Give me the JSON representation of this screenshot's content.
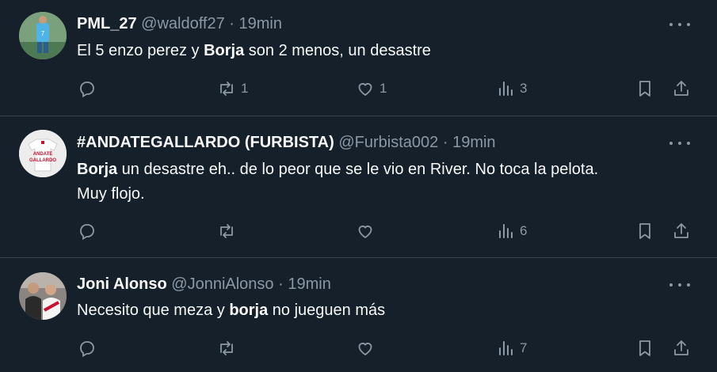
{
  "tweets": [
    {
      "name": "PML_27",
      "handle": "@waldoff27",
      "sep": "·",
      "time": "19min",
      "text_parts": [
        "El 5 enzo perez y ",
        "Borja",
        " son 2 menos, un desastre"
      ],
      "text_parts_2": [],
      "counts": {
        "reply": "",
        "retweet": "1",
        "like": "1",
        "views": "3"
      }
    },
    {
      "name": "#ANDATEGALLARDO (FURBISTA)",
      "handle": "@Furbista002",
      "sep": "·",
      "time": "19min",
      "text_parts": [
        "Borja",
        " un desastre eh.. de lo peor que se le vio en River. No toca la pelota."
      ],
      "text_parts_2": [
        "Muy flojo."
      ],
      "avatar_text": "ANDATE GALLARDO",
      "counts": {
        "reply": "",
        "retweet": "",
        "like": "",
        "views": "6"
      }
    },
    {
      "name": "Joni Alonso",
      "handle": "@JonniAlonso",
      "sep": "·",
      "time": "19min",
      "text_parts": [
        "Necesito que meza y ",
        "borja",
        " no jueguen más"
      ],
      "text_parts_2": [],
      "counts": {
        "reply": "",
        "retweet": "",
        "like": "",
        "views": "7"
      }
    }
  ],
  "icons": [
    "reply-icon",
    "retweet-icon",
    "like-icon",
    "views-icon",
    "bookmark-icon",
    "share-icon",
    "more-icon"
  ],
  "colors": {
    "background": "#15202b",
    "text": "#f7f9f9",
    "muted": "#8b98a5",
    "divider": "#38444d"
  }
}
